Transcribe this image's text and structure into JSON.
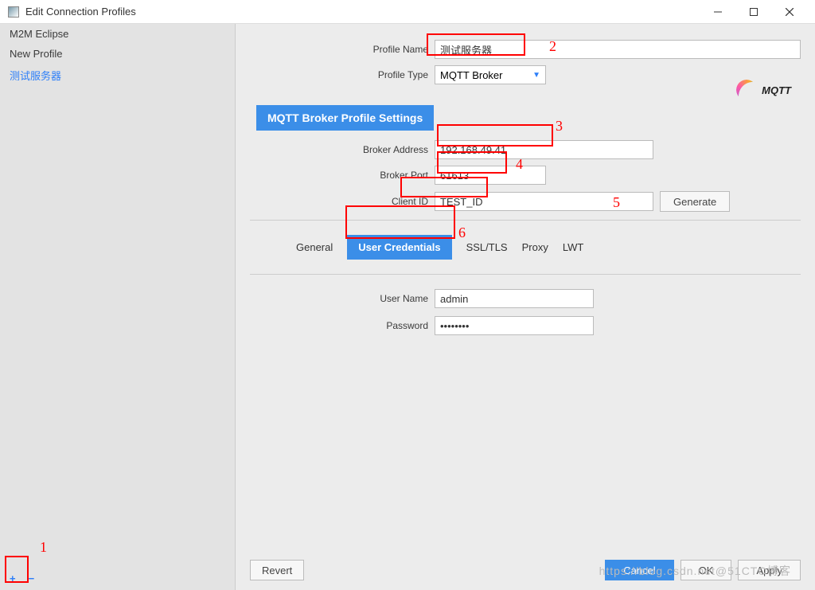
{
  "window": {
    "title": "Edit Connection Profiles"
  },
  "sidebar": {
    "items": [
      {
        "label": "M2M Eclipse"
      },
      {
        "label": "New Profile"
      },
      {
        "label": "测试服务器"
      }
    ]
  },
  "profile": {
    "name_label": "Profile Name",
    "name_value": "测试服务器",
    "type_label": "Profile Type",
    "type_value": "MQTT Broker"
  },
  "logo": {
    "text": "MQTT"
  },
  "section": {
    "title": "MQTT Broker Profile Settings"
  },
  "broker": {
    "address_label": "Broker Address",
    "address_value": "192.168.49.41",
    "port_label": "Broker Port",
    "port_value": "61613",
    "client_id_label": "Client ID",
    "client_id_value": "TEST_ID",
    "generate_label": "Generate"
  },
  "tabs": {
    "general": "General",
    "user_credentials": "User Credentials",
    "ssl": "SSL/TLS",
    "proxy": "Proxy",
    "lwt": "LWT"
  },
  "credentials": {
    "user_label": "User Name",
    "user_value": "admin",
    "pass_label": "Password",
    "pass_value": "••••••••"
  },
  "footer": {
    "revert": "Revert",
    "cancel": "Cancel",
    "ok": "OK",
    "apply": "Apply"
  },
  "watermark": "https://blog.csdn.net@51CTO博客",
  "annotations": {
    "n1": "1",
    "n2": "2",
    "n3": "3",
    "n4": "4",
    "n5": "5",
    "n6": "6"
  },
  "icons": {
    "plus": "+",
    "minus": "−"
  }
}
